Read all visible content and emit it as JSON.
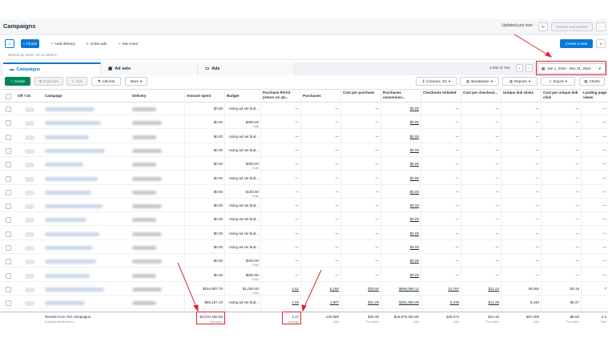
{
  "header": {
    "title": "Campaigns",
    "updated": "Updated just now",
    "refresh_icon": "refresh-icon",
    "review_publish": "Review and publish",
    "more": "···",
    "create_view": "Create a view"
  },
  "filters": {
    "all_ads": "All ads",
    "had_delivery": "Had delivery",
    "active_ads": "Active ads",
    "see_more": "See more",
    "search_placeholder": "Search by name, ID or metrics"
  },
  "tabs": {
    "campaigns": "Campaigns",
    "ad_sets": "Ad sets",
    "ads": "Ads",
    "range": "1-200 of 753",
    "date_range": "Jan 1, 2024 - Dec 31, 2024"
  },
  "toolbar": {
    "create": "Create",
    "duplicate": "Duplicate",
    "edit": "Edit",
    "ab_test": "A/B test",
    "more": "More",
    "columns": "Columns: SS",
    "breakdown": "Breakdown",
    "reports": "Reports",
    "export": "Export",
    "charts": "Charts"
  },
  "columns": [
    "Off / On",
    "Campaign",
    "Delivery",
    "Amount spent",
    "Budget",
    "Purchase ROAS (return on ad...",
    "Purchases",
    "Cost per purchase",
    "Purchases conversion...",
    "Checkouts Initiated",
    "Cost per checkout...",
    "Unique link clicks",
    "Cost per unique link click",
    "Landing page views"
  ],
  "rows": [
    {
      "spent": "$0.00",
      "budget": "Using ad set bud...",
      "budget_sub": "",
      "roas": "—",
      "purchases": "—",
      "cpp": "—",
      "pconv": "$0.00",
      "checkouts": "—",
      "cpc": "—",
      "ulc": "—",
      "cpulc": "—",
      "lpv": "—"
    },
    {
      "spent": "$0.00",
      "budget": "$400.00",
      "budget_sub": "Daily",
      "roas": "—",
      "purchases": "—",
      "cpp": "—",
      "pconv": "$0.00",
      "checkouts": "—",
      "cpc": "—",
      "ulc": "—",
      "cpulc": "—",
      "lpv": "—"
    },
    {
      "spent": "$0.00",
      "budget": "Using ad set bud...",
      "budget_sub": "",
      "roas": "—",
      "purchases": "—",
      "cpp": "—",
      "pconv": "$0.00",
      "checkouts": "—",
      "cpc": "—",
      "ulc": "—",
      "cpulc": "—",
      "lpv": "—"
    },
    {
      "spent": "$0.00",
      "budget": "Using ad set bud...",
      "budget_sub": "",
      "roas": "—",
      "purchases": "—",
      "cpp": "—",
      "pconv": "$0.00",
      "checkouts": "—",
      "cpc": "—",
      "ulc": "—",
      "cpulc": "—",
      "lpv": "—"
    },
    {
      "spent": "$0.00",
      "budget": "$300.00",
      "budget_sub": "Daily",
      "roas": "—",
      "purchases": "—",
      "cpp": "—",
      "pconv": "$0.00",
      "checkouts": "—",
      "cpc": "—",
      "ulc": "—",
      "cpulc": "—",
      "lpv": "—"
    },
    {
      "spent": "$0.00",
      "budget": "Using ad set bud...",
      "budget_sub": "",
      "roas": "—",
      "purchases": "—",
      "cpp": "—",
      "pconv": "$0.00",
      "checkouts": "—",
      "cpc": "—",
      "ulc": "—",
      "cpulc": "—",
      "lpv": "—"
    },
    {
      "spent": "$0.00",
      "budget": "$150.00",
      "budget_sub": "Daily",
      "roas": "—",
      "purchases": "—",
      "cpp": "—",
      "pconv": "$0.00",
      "checkouts": "—",
      "cpc": "—",
      "ulc": "—",
      "cpulc": "—",
      "lpv": "—"
    },
    {
      "spent": "$0.00",
      "budget": "Using ad set bud...",
      "budget_sub": "",
      "roas": "—",
      "purchases": "—",
      "cpp": "—",
      "pconv": "$0.00",
      "checkouts": "—",
      "cpc": "—",
      "ulc": "—",
      "cpulc": "—",
      "lpv": "—"
    },
    {
      "spent": "$0.00",
      "budget": "Using ad set bud...",
      "budget_sub": "",
      "roas": "—",
      "purchases": "—",
      "cpp": "—",
      "pconv": "$0.00",
      "checkouts": "—",
      "cpc": "—",
      "ulc": "—",
      "cpulc": "—",
      "lpv": "—"
    },
    {
      "spent": "$0.00",
      "budget": "Using ad set bud...",
      "budget_sub": "",
      "roas": "—",
      "purchases": "—",
      "cpp": "—",
      "pconv": "$0.00",
      "checkouts": "—",
      "cpc": "—",
      "ulc": "—",
      "cpulc": "—",
      "lpv": "—"
    },
    {
      "spent": "$0.00",
      "budget": "Using ad set bud...",
      "budget_sub": "",
      "roas": "—",
      "purchases": "—",
      "cpp": "—",
      "pconv": "$0.00",
      "checkouts": "—",
      "cpc": "—",
      "ulc": "—",
      "cpulc": "—",
      "lpv": "—"
    },
    {
      "spent": "$0.00",
      "budget": "$200.00",
      "budget_sub": "Daily",
      "roas": "—",
      "purchases": "—",
      "cpp": "—",
      "pconv": "$0.00",
      "checkouts": "—",
      "cpc": "—",
      "ulc": "—",
      "cpulc": "—",
      "lpv": "—"
    },
    {
      "spent": "$0.00",
      "budget": "$500.00",
      "budget_sub": "Daily",
      "roas": "—",
      "purchases": "—",
      "cpp": "—",
      "pconv": "$0.00",
      "checkouts": "—",
      "cpc": "—",
      "ulc": "—",
      "cpulc": "—",
      "lpv": "—"
    },
    {
      "spent": "$154,807.75",
      "budget": "$1,000.00",
      "budget_sub": "Daily",
      "roas": "4.51",
      "purchases": "5,180",
      "cpp": "$29.90",
      "pconv": "$698,080.12",
      "checkouts": "13,797",
      "cpc": "$11.23",
      "ulc": "48,592",
      "cpulc": "$3.19",
      "lpv": "7"
    },
    {
      "spent": "$59,157.10",
      "budget": "Using ad set bud...",
      "budget_sub": "",
      "roas": "4.26",
      "purchases": "1,907",
      "cpp": "$31.09",
      "pconv": "$251,950.96",
      "checkouts": "5,238",
      "cpc": "$11.29",
      "ulc": "9,440",
      "cpulc": "$6.27",
      "lpv": ""
    }
  ],
  "totals": {
    "label": "Results from 753 campaigns",
    "sublabel": "Excludes deleted items",
    "spent": "$4,070,456.58",
    "spent_sub": "Total spent",
    "roas": "4.17",
    "roas_sub": "Average",
    "purchases": "133,989",
    "purchases_sub": "Total",
    "cpp": "$30.38",
    "cpp_sub": "Per Action",
    "pconv": "$16,979,363.90",
    "pconv_sub": "Total",
    "checkouts": "330,074",
    "checkouts_sub": "Total",
    "cpc": "$12.33",
    "cpc_sub": "Per Action",
    "ulc": "587,008",
    "ulc_sub": "Total",
    "cpulc": "$6.93",
    "cpulc_sub": "Per Action",
    "lpv": "2.3",
    "lpv_sub": "Total"
  },
  "colors": {
    "accent": "#0a78d6",
    "annotation": "#e0242f"
  }
}
